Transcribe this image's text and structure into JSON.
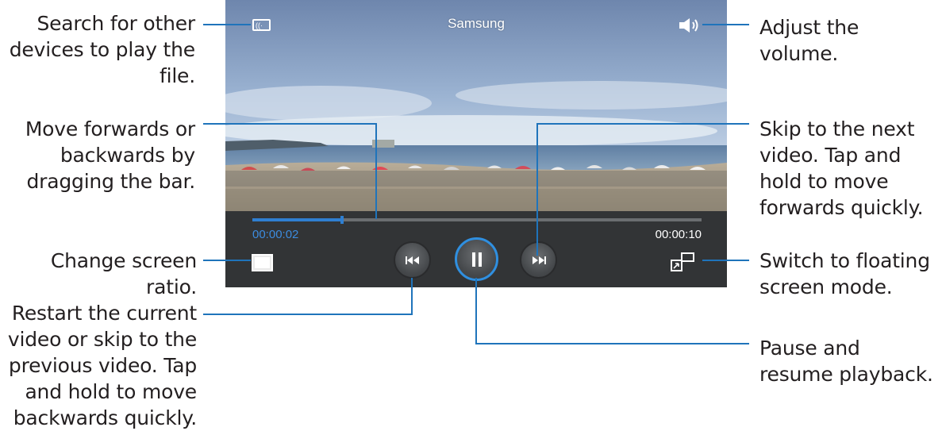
{
  "player": {
    "title": "Samsung",
    "elapsed_time": "00:00:02",
    "total_time": "00:00:10",
    "progress_fraction": 0.2,
    "accent_color": "#2f7fd1",
    "icons": {
      "cast": "cast-device-icon",
      "volume": "speaker-volume-icon",
      "ratio": "screen-ratio-icon",
      "prev": "skip-previous-icon",
      "pause": "pause-icon",
      "next": "skip-next-icon",
      "floating": "floating-screen-icon"
    }
  },
  "callouts": {
    "search_devices": "Search for other devices to play the file.",
    "drag_bar": "Move forwards or backwards by dragging the bar.",
    "screen_ratio": "Change screen ratio.",
    "restart": "Restart the current video or skip to the previous video. Tap and hold to move backwards quickly.",
    "volume": "Adjust the volume.",
    "skip_next": "Skip to the next video. Tap and hold to move forwards quickly.",
    "floating": "Switch to floating screen mode.",
    "pause": "Pause and resume playback."
  }
}
